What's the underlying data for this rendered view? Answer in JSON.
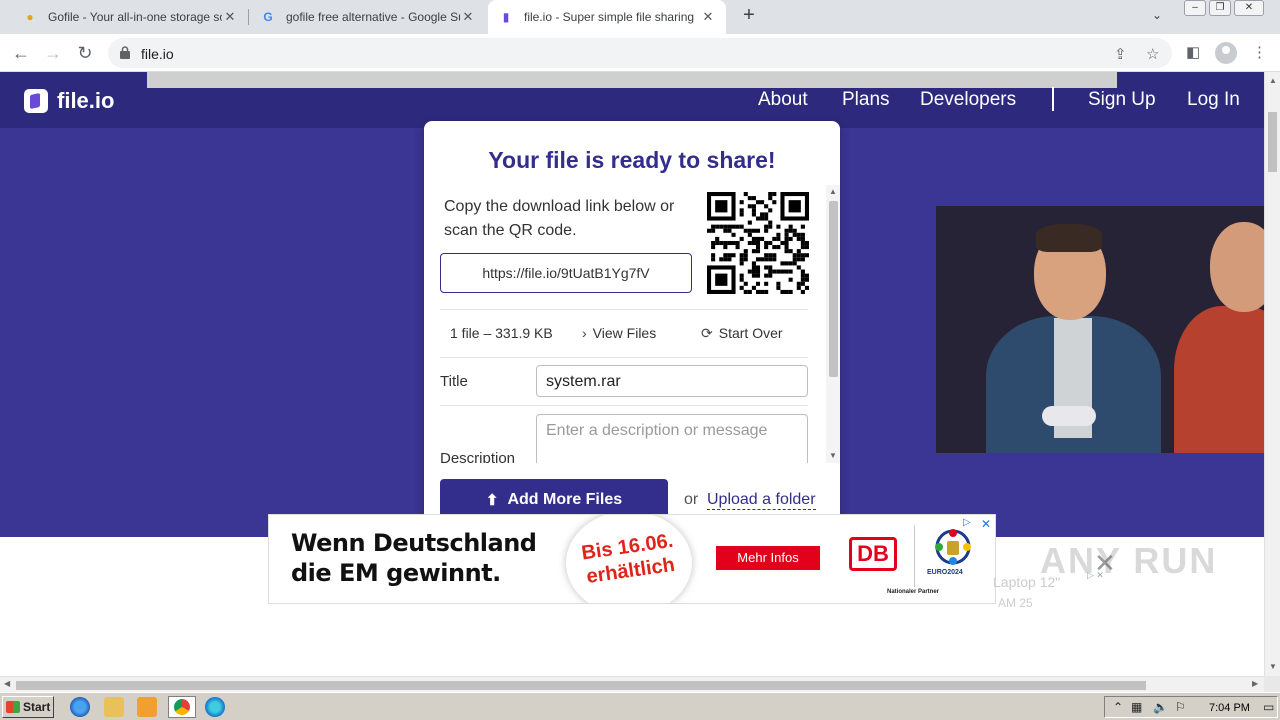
{
  "browser": {
    "tabs": [
      {
        "title": "Gofile - Your all-in-one storage solution",
        "icon": "gofile-icon"
      },
      {
        "title": "gofile free alternative - Google Suche",
        "icon": "google-icon"
      },
      {
        "title": "file.io - Super simple file sharing",
        "icon": "fileio-icon"
      }
    ],
    "url": "file.io"
  },
  "site": {
    "logo": "file.io",
    "nav": {
      "about": "About",
      "plans": "Plans",
      "developers": "Developers",
      "signup": "Sign Up",
      "login": "Log In"
    },
    "colors": {
      "primary": "#332e8c",
      "hero": "#3b3593",
      "navbar": "#2d2a7d"
    }
  },
  "card": {
    "title": "Your file is ready to share!",
    "instructions": "Copy the download link below or scan the QR code.",
    "link": "https://file.io/9tUatB1Yg7fV",
    "file_summary": "1 file – 331.9 KB",
    "view_files": "View Files",
    "start_over": "Start Over",
    "title_label": "Title",
    "title_value": "system.rar",
    "description_label": "Description",
    "description_placeholder": "Enter a description or message",
    "add_more": "Add More Files",
    "or": "or",
    "upload_folder": "Upload a folder"
  },
  "ad": {
    "line1": "Wenn Deutschland",
    "line2": "die EM gewinnt.",
    "badge_line1": "Bis 16.06.",
    "badge_line2": "erhältlich",
    "cta": "Mehr Infos",
    "brand": "DB",
    "euro": "EURO2024",
    "partner": "Nationaler Partner",
    "behind_1": "Laptop 12\"",
    "behind_2": "AM 25"
  },
  "watermark": "ANY RUN",
  "taskbar": {
    "start": "Start",
    "clock": "7:04 PM"
  }
}
